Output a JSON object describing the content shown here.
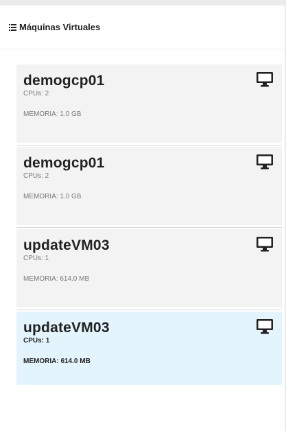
{
  "panel": {
    "title": "Máquinas Virtuales",
    "title_icon": "list-icon"
  },
  "vms": [
    {
      "name": "demogcp01",
      "cpus": "CPUs: 2",
      "memory": "MEMORIA: 1.0 GB",
      "icon": "desktop-icon",
      "selected": false
    },
    {
      "name": "demogcp01",
      "cpus": "CPUs: 2",
      "memory": "MEMORIA: 1.0 GB",
      "icon": "desktop-icon",
      "selected": false
    },
    {
      "name": "updateVM03",
      "cpus": "CPUs: 1",
      "memory": "MEMORIA: 614.0 MB",
      "icon": "desktop-icon",
      "selected": false
    },
    {
      "name": "updateVM03",
      "cpus": "CPUs: 1",
      "memory": "MEMORIA: 614.0 MB",
      "icon": "desktop-icon",
      "selected": true
    }
  ],
  "colors": {
    "card_bg": "#f3f3f3",
    "selected_bg": "#e3f4fc",
    "text": "#222222",
    "muted_text": "#777777"
  }
}
